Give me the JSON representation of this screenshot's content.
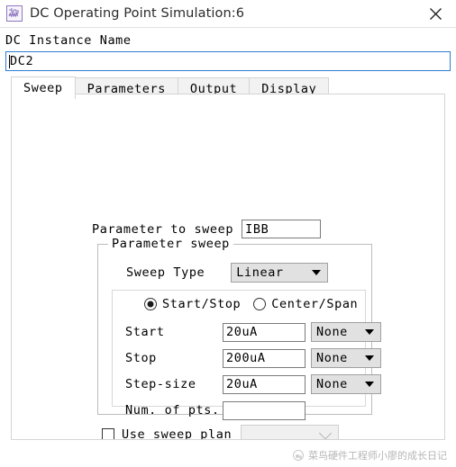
{
  "window": {
    "title": "DC Operating Point Simulation:6",
    "icon": "waveform-icon",
    "close_label": "close-icon"
  },
  "instance": {
    "label": "DC Instance Name",
    "value": "DC2"
  },
  "tabs": [
    {
      "label": "Sweep",
      "active": true
    },
    {
      "label": "Parameters",
      "active": false
    },
    {
      "label": "Output",
      "active": false
    },
    {
      "label": "Display",
      "active": false
    }
  ],
  "sweep": {
    "parameter_to_sweep": {
      "label": "Parameter to sweep",
      "value": "IBB"
    },
    "group": {
      "title": "Parameter sweep",
      "sweep_type": {
        "label": "Sweep Type",
        "value": "Linear"
      },
      "mode": {
        "start_stop_label": "Start/Stop",
        "center_span_label": "Center/Span",
        "selected": "Start/Stop"
      },
      "fields": [
        {
          "label": "Start",
          "value": "20uA",
          "unit": "None"
        },
        {
          "label": "Stop",
          "value": "200uA",
          "unit": "None"
        },
        {
          "label": "Step-size",
          "value": "20uA",
          "unit": "None"
        }
      ],
      "num_points": {
        "label": "Num. of pts.",
        "value": ""
      }
    },
    "use_sweep_plan": {
      "label": "Use sweep plan",
      "checked": false,
      "plan_value": ""
    }
  },
  "watermark": {
    "text": "菜鸟硬件工程师小廖的成长日记"
  },
  "colors": {
    "accent": "#2f7fd1",
    "icon": "#8f77c0",
    "combo_bg": "#e1e1e1"
  }
}
